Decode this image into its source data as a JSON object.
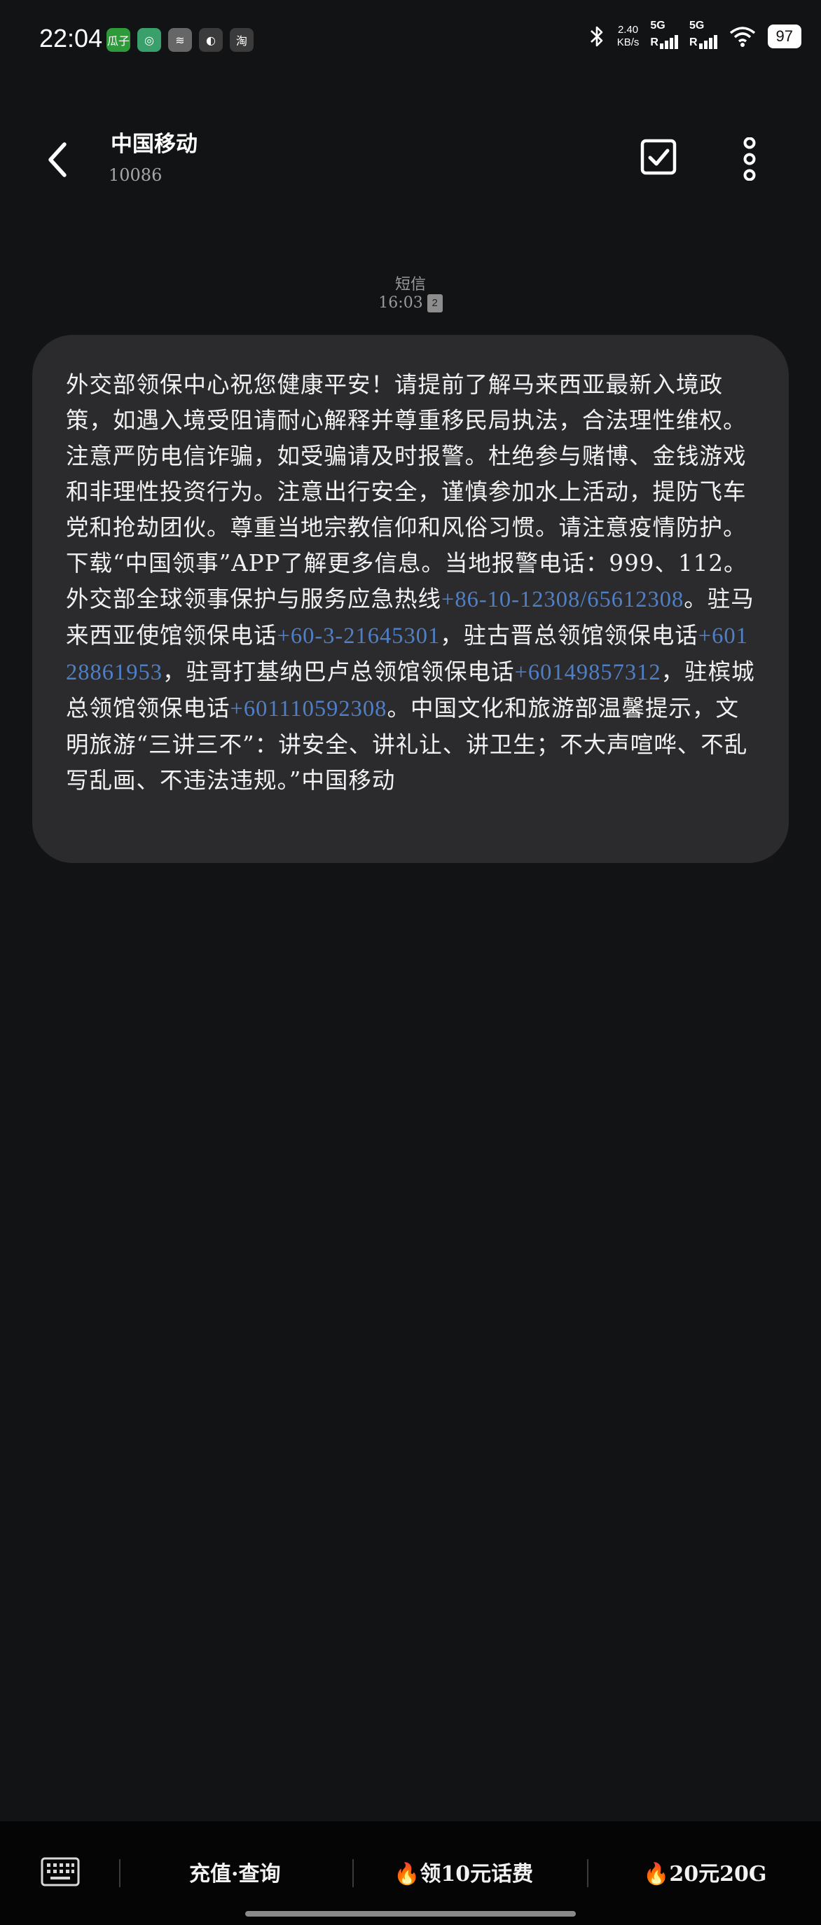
{
  "status": {
    "time": "22:04",
    "net_speed_value": "2.40",
    "net_speed_unit": "KB/s",
    "sim1": "5G",
    "sim2": "5G",
    "roaming": "R",
    "battery": "97",
    "app_icons": [
      {
        "name": "guazi-app-icon",
        "text": "瓜子",
        "color": "#2e9a3a"
      },
      {
        "name": "leaf-app-icon",
        "text": "◎",
        "color": "#3aa06b"
      },
      {
        "name": "capcut-app-icon",
        "text": "≋",
        "color": "#666666"
      },
      {
        "name": "bird-app-icon",
        "text": "◐",
        "color": "#3b3b3b"
      },
      {
        "name": "taobao-app-icon",
        "text": "淘",
        "color": "#3b3b3b"
      }
    ]
  },
  "header": {
    "title": "中国移动",
    "subtitle": "10086"
  },
  "meta": {
    "type": "短信",
    "time": "16:03",
    "sim_badge": "2"
  },
  "message": {
    "part1": "外交部领保中心祝您健康平安！请提前了解马来西亚最新入境政策，如遇入境受阻请耐心解释并尊重移民局执法，合法理性维权。注意严防电信诈骗，如受骗请及时报警。杜绝参与赌博、金钱游戏和非理性投资行为。注意出行安全，谨慎参加水上活动，提防飞车党和抢劫团伙。尊重当地宗教信仰和风俗习惯。请注意疫情防护。下载“中国领事”APP了解更多信息。当地报警电话：999、112。外交部全球领事保护与服务应急热线",
    "link1": "+86-10-12308/65612308",
    "part2": "。驻马来西亚使馆领保电话",
    "link2": "+60-3-21645301",
    "part3": "，驻古晋总领馆领保电话",
    "link3": "+60128861953",
    "part4": "，驻哥打基纳巴卢总领馆领保电话",
    "link4": "+60149857312",
    "part5": "，驻槟城总领馆领保电话",
    "link5": "+601110592308",
    "part6": "。中国文化和旅游部温馨提示，文明旅游“三讲三不”：讲安全、讲礼让、讲卫生；不大声喧哗、不乱写乱画、不违法违规。”中国移动"
  },
  "bottom": {
    "menu1": "充值·查询",
    "menu2": "领10元话费",
    "menu3": "20元20G",
    "fire_icon": "🔥"
  },
  "colors": {
    "background": "#121315",
    "bubble": "#2b2b2d",
    "link": "#4f7fc6"
  }
}
